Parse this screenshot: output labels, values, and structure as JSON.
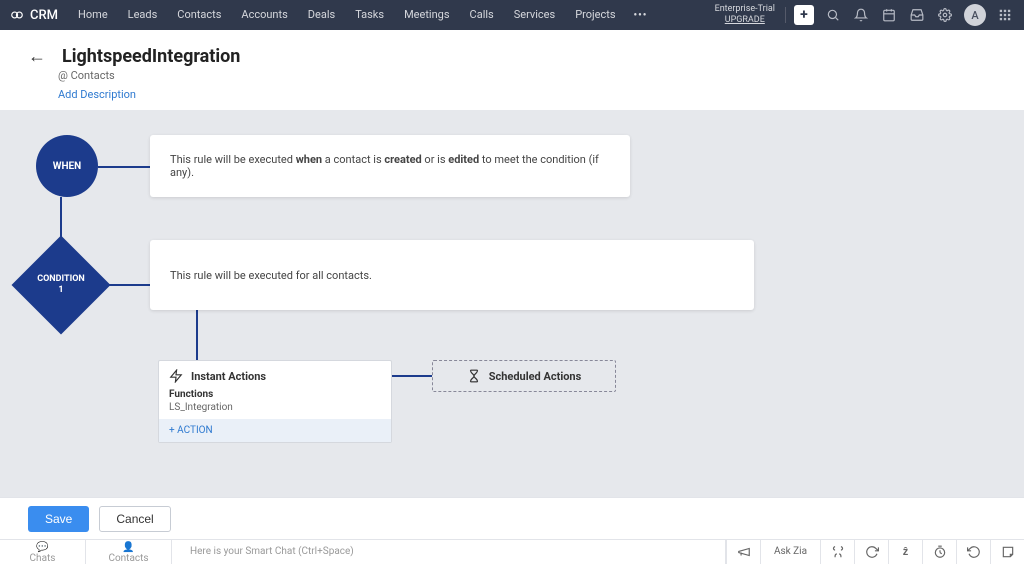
{
  "navbar": {
    "brand": "CRM",
    "items": [
      "Home",
      "Leads",
      "Contacts",
      "Accounts",
      "Deals",
      "Tasks",
      "Meetings",
      "Calls",
      "Services",
      "Projects"
    ],
    "trial_line1": "Enterprise-Trial",
    "trial_upgrade": "UPGRADE",
    "avatar_initial": "A"
  },
  "page": {
    "title": "LightspeedIntegration",
    "subtitle_prefix": "@ ",
    "subtitle_module": "Contacts",
    "add_description": "Add Description"
  },
  "when": {
    "node_label": "WHEN",
    "text_pre": "This rule will be executed ",
    "text_bold1": "when",
    "text_mid1": " a contact is ",
    "text_bold2": "created",
    "text_mid2": " or is ",
    "text_bold3": "edited",
    "text_post": " to meet the condition (if any)."
  },
  "condition": {
    "node_label_line1": "CONDITION",
    "node_label_line2": "1",
    "text": "This rule will be executed for all contacts."
  },
  "instant_actions": {
    "title": "Instant Actions",
    "section_title": "Functions",
    "section_item": "LS_Integration",
    "add_label": "+ ACTION"
  },
  "scheduled_actions": {
    "title": "Scheduled Actions"
  },
  "footer": {
    "save": "Save",
    "cancel": "Cancel"
  },
  "bottombar": {
    "chats": "Chats",
    "contacts": "Contacts",
    "smart_chat_hint": "Here is your Smart Chat (Ctrl+Space)",
    "ask_zia": "Ask Zia"
  }
}
